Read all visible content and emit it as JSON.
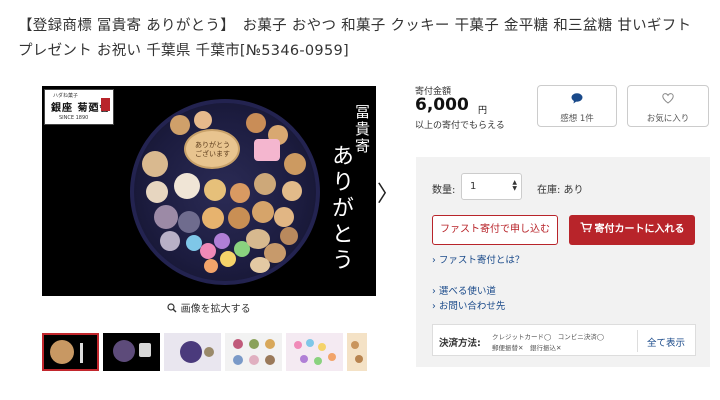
{
  "product": {
    "title": "【登録商標 冨貴寄 ありがとう】　お菓子 おやつ 和菓子 クッキー 干菓子 金平糖 和三盆糖 甘いギフト プレゼント お祝い 千葉県 千葉市[№5346-0959]"
  },
  "image": {
    "logo_small": "ハダね菓子",
    "logo_main": "銀座 菊廼舎",
    "logo_since": "SINCE 1890",
    "plaque_text": "ありがとう ございます",
    "vertical_title_1": "冨貴寄",
    "vertical_title_2": "ありがとう",
    "zoom_label": "画像を拡大する",
    "next_arrow": "〉"
  },
  "price": {
    "label": "寄付金額",
    "amount": "6,000",
    "unit": "円",
    "note": "以上の寄付でもらえる"
  },
  "actions": {
    "review_label": "感想 1件",
    "favorite_label": "お気に入り"
  },
  "purchase": {
    "quantity_label": "数量:",
    "quantity_value": "1",
    "stock_label": "在庫: あり",
    "fast_button": "ファスト寄付で申し込む",
    "cart_button": "寄付カートに入れる",
    "fast_link": "ファスト寄付とは？",
    "usage_link": "選べる使い道",
    "contact_link": "お問い合わせ先"
  },
  "payment": {
    "label": "決済方法:",
    "line1": "クレジットカード◯　コンビニ決済◯",
    "line2": "郵便振替✕　銀行振込✕",
    "show_all": "全て表示"
  },
  "colors": {
    "accent": "#b8242a",
    "link": "#1a4a8a",
    "panel_bg": "#f2f2f2"
  }
}
